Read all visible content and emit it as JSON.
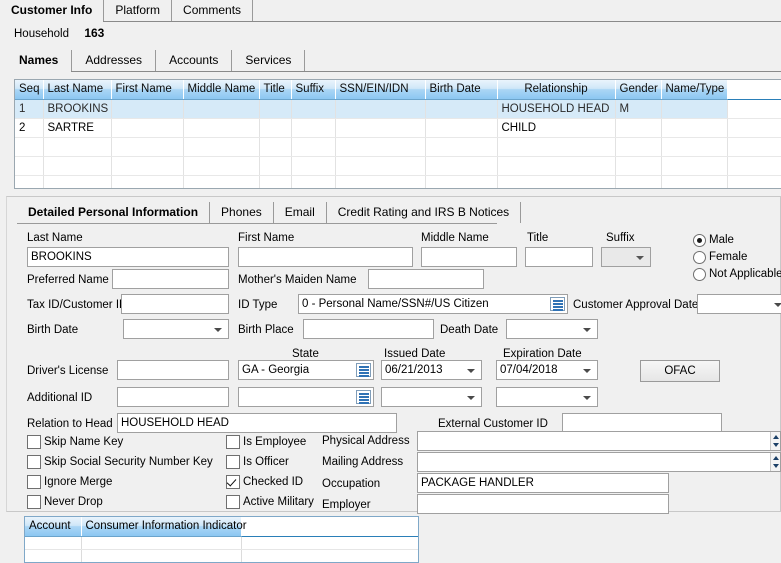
{
  "top_tabs": [
    {
      "label": "Customer Info",
      "active": true
    },
    {
      "label": "Platform",
      "active": false
    },
    {
      "label": "Comments",
      "active": false
    }
  ],
  "household": {
    "label": "Household",
    "value": "163"
  },
  "sub_tabs": [
    {
      "label": "Names",
      "active": true
    },
    {
      "label": "Addresses",
      "active": false
    },
    {
      "label": "Accounts",
      "active": false
    },
    {
      "label": "Services",
      "active": false
    }
  ],
  "names_grid": {
    "columns": [
      "Seq",
      "Last Name",
      "First Name",
      "Middle Name",
      "Title",
      "Suffix",
      "SSN/EIN/IDN",
      "Birth Date",
      "Relationship",
      "Gender",
      "Name/Type"
    ],
    "rows": [
      {
        "selected": true,
        "cells": [
          "1",
          "BROOKINS",
          "",
          "",
          "",
          "",
          "",
          "",
          "HOUSEHOLD HEAD",
          "M",
          ""
        ]
      },
      {
        "selected": false,
        "cells": [
          "2",
          "SARTRE",
          "",
          "",
          "",
          "",
          "",
          "",
          "CHILD",
          "",
          ""
        ]
      },
      {
        "selected": false,
        "cells": [
          "",
          "",
          "",
          "",
          "",
          "",
          "",
          "",
          "",
          "",
          ""
        ]
      },
      {
        "selected": false,
        "cells": [
          "",
          "",
          "",
          "",
          "",
          "",
          "",
          "",
          "",
          "",
          ""
        ]
      },
      {
        "selected": false,
        "cells": [
          "",
          "",
          "",
          "",
          "",
          "",
          "",
          "",
          "",
          "",
          ""
        ]
      }
    ]
  },
  "detail_tabs": [
    {
      "label": "Detailed Personal Information",
      "active": true
    },
    {
      "label": "Phones",
      "active": false
    },
    {
      "label": "Email",
      "active": false
    },
    {
      "label": "Credit Rating and IRS B Notices",
      "active": false
    }
  ],
  "detail": {
    "last_name_label": "Last Name",
    "last_name_value": "BROOKINS",
    "first_name_label": "First Name",
    "first_name_value": "",
    "middle_name_label": "Middle Name",
    "middle_name_value": "",
    "title_label": "Title",
    "title_value": "",
    "suffix_label": "Suffix",
    "suffix_value": "",
    "preferred_name_label": "Preferred Name",
    "preferred_name_value": "",
    "mothers_maiden_name_label": "Mother's Maiden Name",
    "mothers_maiden_name_value": "",
    "tax_id_label": "Tax ID/Customer ID",
    "tax_id_value": "",
    "id_type_label": "ID Type",
    "id_type_value": "0 - Personal Name/SSN#/US Citizen",
    "customer_approval_date_label": "Customer Approval Date",
    "customer_approval_date_value": "",
    "birth_date_label": "Birth Date",
    "birth_date_value": "",
    "birth_place_label": "Birth Place",
    "birth_place_value": "",
    "death_date_label": "Death Date",
    "death_date_value": "",
    "state_label": "State",
    "issued_date_label": "Issued Date",
    "expiration_date_label": "Expiration Date",
    "drivers_license_label": "Driver's License",
    "drivers_license_value": "",
    "drivers_license_state": "GA - Georgia",
    "drivers_license_issued": "06/21/2013",
    "drivers_license_expiration": "07/04/2018",
    "additional_id_label": "Additional ID",
    "additional_id_value": "",
    "additional_id_state": "",
    "additional_id_issued": "",
    "additional_id_expiration": "",
    "ofac_button_label": "OFAC",
    "relation_to_head_label": "Relation to Head",
    "relation_to_head_value": "HOUSEHOLD HEAD",
    "external_customer_id_label": "External Customer ID",
    "external_customer_id_value": "",
    "gender": {
      "options": [
        {
          "label": "Male",
          "selected": true
        },
        {
          "label": "Female",
          "selected": false
        },
        {
          "label": "Not Applicable",
          "selected": false
        }
      ]
    },
    "checkboxes_left": [
      {
        "label": "Skip Name Key",
        "checked": false
      },
      {
        "label": "Skip Social Security Number Key",
        "checked": false
      },
      {
        "label": "Ignore Merge",
        "checked": false
      },
      {
        "label": "Never Drop",
        "checked": false
      }
    ],
    "checkboxes_mid": [
      {
        "label": "Is Employee",
        "checked": false
      },
      {
        "label": "Is Officer",
        "checked": false
      },
      {
        "label": "Checked ID",
        "checked": true
      },
      {
        "label": "Active Military",
        "checked": false
      }
    ],
    "physical_address_label": "Physical Address",
    "physical_address_value": "",
    "mailing_address_label": "Mailing Address",
    "mailing_address_value": "",
    "occupation_label": "Occupation",
    "occupation_value": "PACKAGE HANDLER",
    "employer_label": "Employer",
    "employer_value": ""
  },
  "mini_grid": {
    "columns": [
      "Account",
      "Consumer Information Indicator"
    ],
    "rows": [
      {
        "cells": [
          "",
          ""
        ]
      },
      {
        "cells": [
          "",
          ""
        ]
      }
    ]
  },
  "colors": {
    "header_blue": "#8cc7f2",
    "selected_row": "#d6eaf8",
    "window_bg": "#f0f0f0",
    "border_grey": "#9a9a9a"
  }
}
